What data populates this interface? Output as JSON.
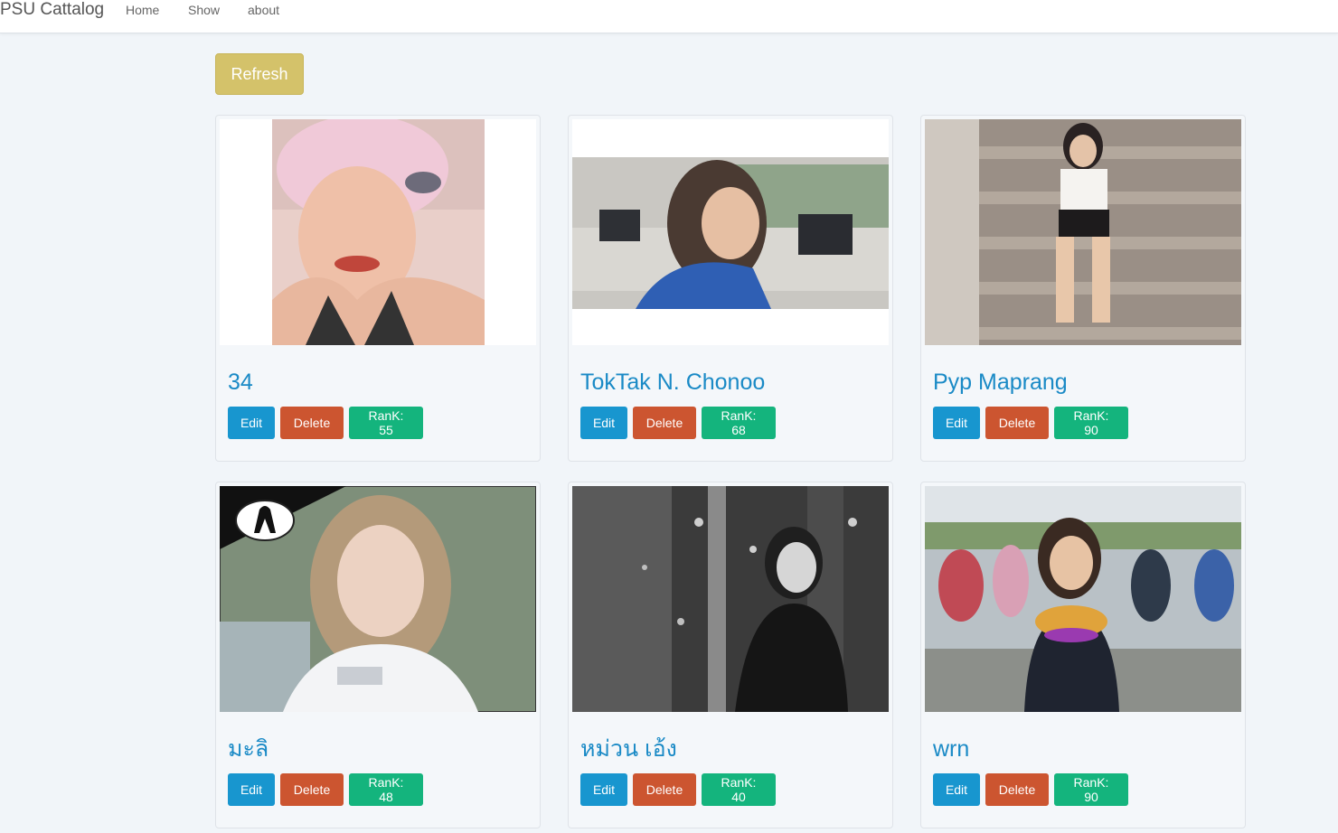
{
  "navbar": {
    "brand": "PSU Cattalog",
    "links": [
      "Home",
      "Show",
      "about"
    ]
  },
  "refresh_label": "Refresh",
  "buttons": {
    "edit": "Edit",
    "delete": "Delete"
  },
  "colors": {
    "refresh": "#d4c26a",
    "edit": "#1896cf",
    "delete": "#cc5530",
    "rank": "#14b47d",
    "title": "#1a8ac6"
  },
  "cards": [
    {
      "title": "34",
      "rank": "RanK: 55"
    },
    {
      "title": "TokTak N. Chonoo",
      "rank": "RanK: 68"
    },
    {
      "title": "Pyp Maprang",
      "rank": "RanK: 90"
    },
    {
      "title": "มะลิ",
      "rank": "RanK: 48"
    },
    {
      "title": "หม่วน เอ้ง",
      "rank": "RanK: 40"
    },
    {
      "title": "wrn",
      "rank": "RanK: 90"
    }
  ]
}
